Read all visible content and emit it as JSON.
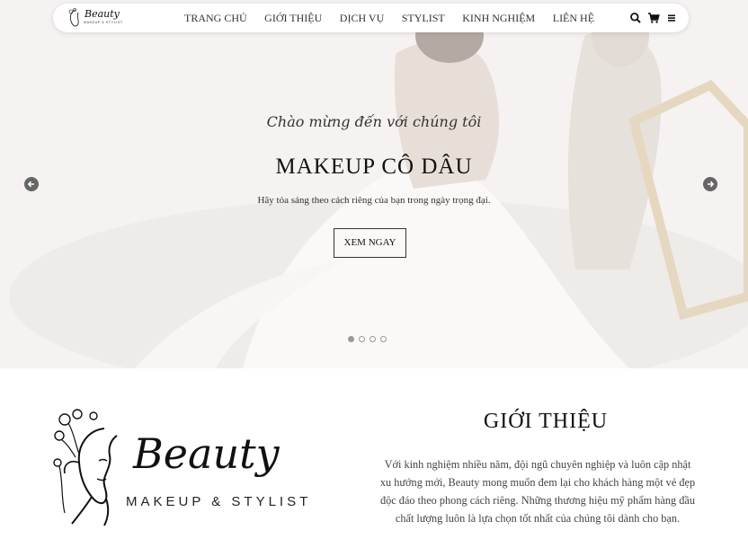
{
  "brand": {
    "name": "Beauty",
    "tagline": "MAKEUP & STYLIST"
  },
  "nav": {
    "items": [
      "TRANG CHỦ",
      "GIỚI THIỆU",
      "DỊCH VỤ",
      "STYLIST",
      "KINH NGHIỆM",
      "LIÊN HỆ"
    ],
    "icons": [
      "search-icon",
      "cart-icon",
      "menu-icon"
    ]
  },
  "hero": {
    "script": "Chào mừng đến với chúng tôi",
    "title": "MAKEUP CÔ DÂU",
    "subtitle": "Hãy tỏa sáng theo cách riêng của bạn trong ngày trọng đại.",
    "cta": "XEM NGAY",
    "slide_count": 4,
    "active_slide": 1
  },
  "intro": {
    "title": "GIỚI THIỆU",
    "text": "Với kinh nghiệm nhiều năm, đội ngũ chuyên nghiệp và luôn cập nhật xu hướng mới, Beauty mong muốn đem lại cho khách hàng một vẻ đẹp độc đáo theo phong cách riêng. Những thương hiệu mỹ phẩm hàng đầu chất lượng luôn là lựa chọn tốt nhất của chúng tôi dành cho bạn."
  },
  "colors": {
    "text_dark": "#111111",
    "arrow_bg": "#666666",
    "hero_bg": "#e9e4e0"
  }
}
